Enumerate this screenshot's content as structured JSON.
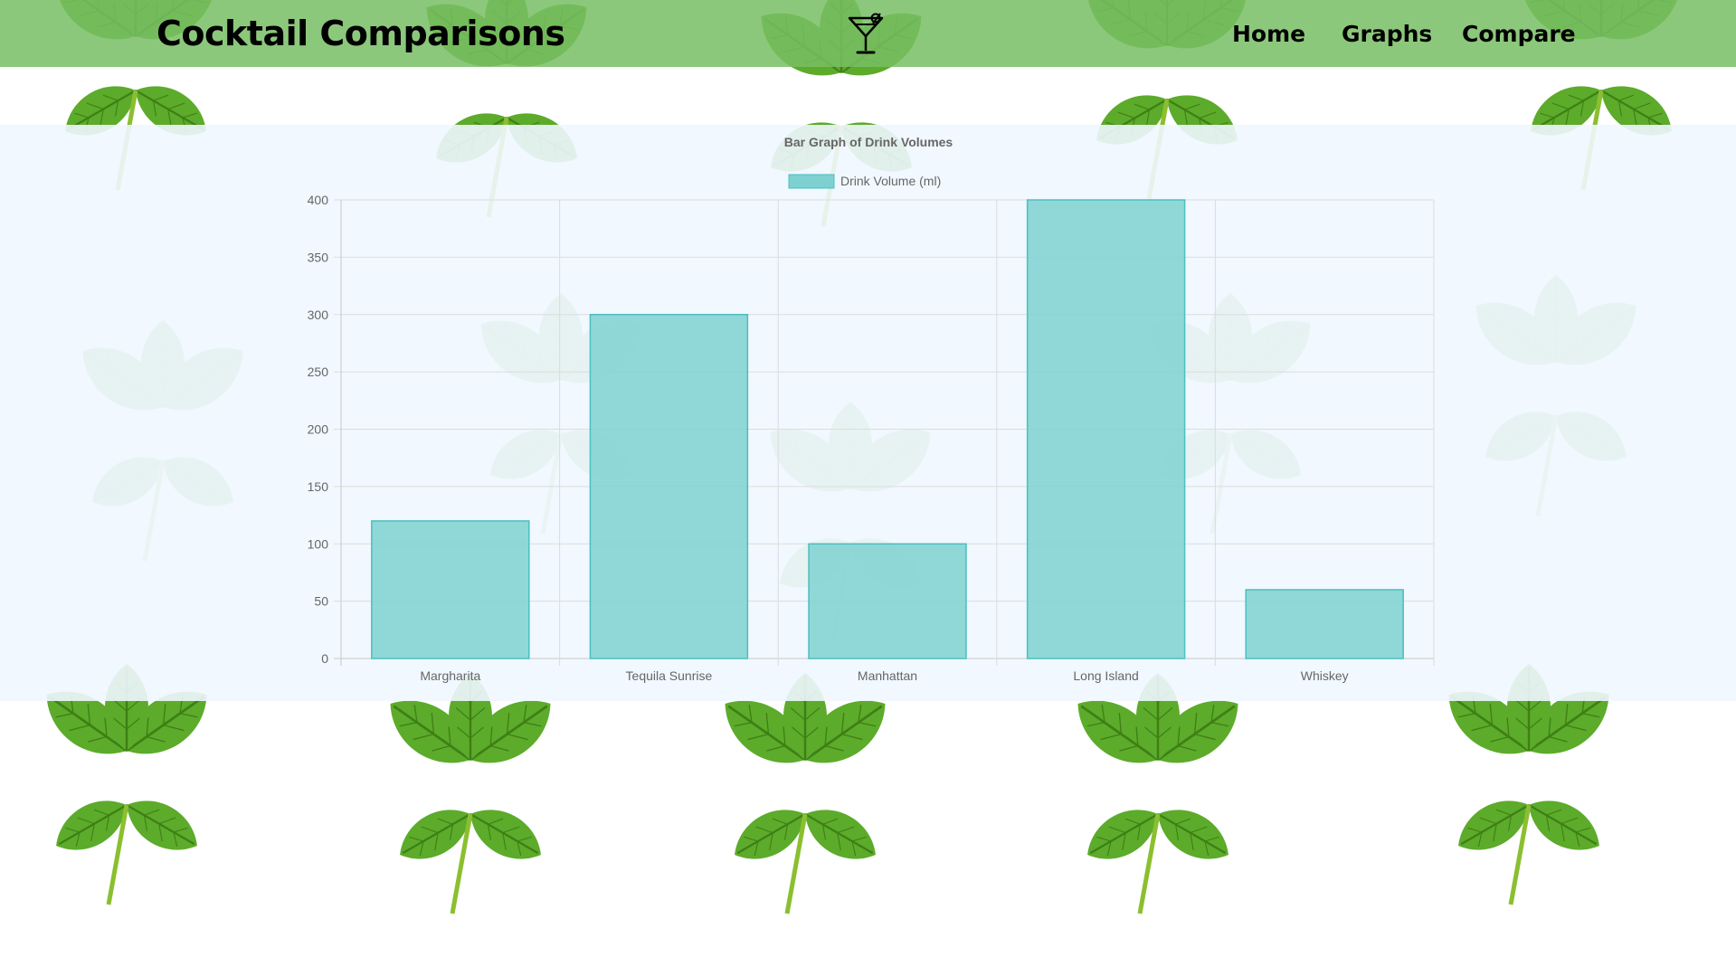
{
  "header": {
    "brand": "Cocktail Comparisons",
    "logo_icon": "martini-glass-icon",
    "nav": [
      {
        "label": "Home"
      },
      {
        "label": "Graphs"
      },
      {
        "label": "Compare"
      }
    ]
  },
  "background": {
    "theme": "mint leaves on white",
    "colors": [
      "#4f9d1f",
      "#7cc23a",
      "#ffffff"
    ]
  },
  "chart_data": {
    "type": "bar",
    "title": "Bar Graph of Drink Volumes",
    "categories": [
      "Margharita",
      "Tequila Sunrise",
      "Manhattan",
      "Long Island",
      "Whiskey"
    ],
    "series": [
      {
        "name": "Drink Volume (ml)",
        "values": [
          120,
          300,
          100,
          400,
          60
        ],
        "color": "#7fd1d1",
        "border": "#4bbfbf"
      }
    ],
    "yticks": [
      0,
      50,
      100,
      150,
      200,
      250,
      300,
      350,
      400
    ],
    "ylim": [
      0,
      400
    ],
    "grid": true,
    "legend": "top"
  }
}
